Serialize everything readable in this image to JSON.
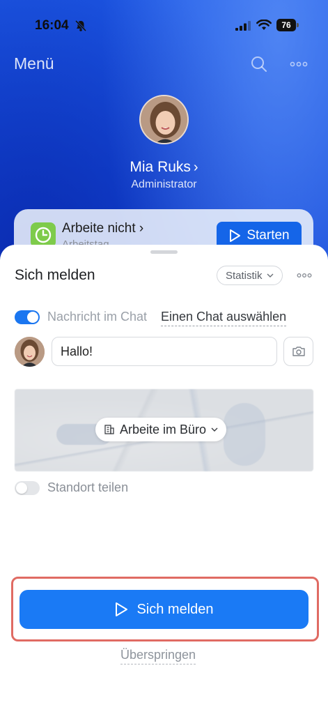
{
  "status_bar": {
    "time": "16:04",
    "battery": "76"
  },
  "header": {
    "title": "Menü"
  },
  "profile": {
    "name": "Mia Ruks",
    "role": "Administrator"
  },
  "work_card": {
    "status": "Arbeite nicht",
    "subtitle": "Arbeitstag",
    "start_label": "Starten"
  },
  "sheet": {
    "title": "Sich melden",
    "stats_label": "Statistik",
    "chat": {
      "label": "Nachricht im Chat",
      "select_link": "Einen Chat auswählen",
      "enabled": true
    },
    "message": {
      "value": "Hallo!"
    },
    "location_mode": "Arbeite im Büro",
    "share_location": {
      "label": "Standort teilen",
      "enabled": false
    },
    "checkin_label": "Sich melden",
    "skip_label": "Überspringen"
  },
  "colors": {
    "accent": "#1a7af5",
    "highlight": "#e06b63",
    "clock_green": "#7ecb4b"
  }
}
